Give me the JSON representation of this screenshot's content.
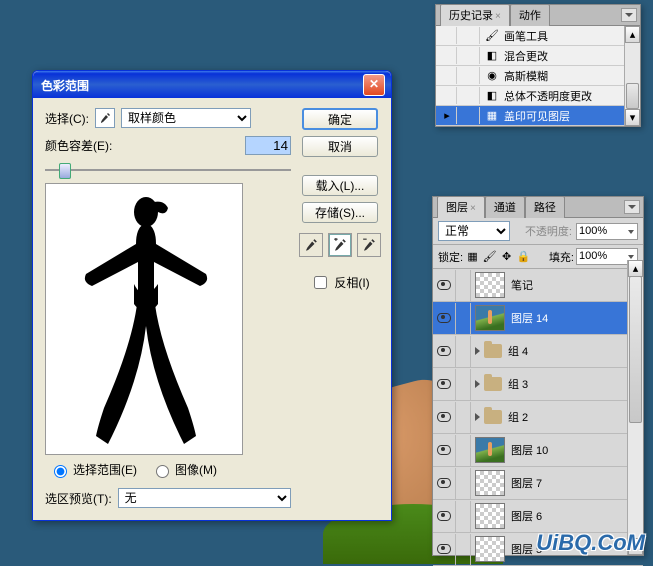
{
  "dialog": {
    "title": "色彩范围",
    "select_label": "选择(C):",
    "select_value": "取样颜色",
    "fuzziness_label": "颜色容差(E):",
    "fuzziness_value": "14",
    "radio_selection": "选择范围(E)",
    "radio_image": "图像(M)",
    "preview_label": "选区预览(T):",
    "preview_value": "无",
    "ok": "确定",
    "cancel": "取消",
    "load": "载入(L)...",
    "save": "存储(S)...",
    "invert": "反相(I)"
  },
  "history": {
    "tab_history": "历史记录",
    "tab_actions": "动作",
    "items": [
      "画笔工具",
      "混合更改",
      "高斯模糊",
      "总体不透明度更改",
      "盖印可见图层"
    ]
  },
  "layers": {
    "tab_layers": "图层",
    "tab_channels": "通道",
    "tab_paths": "路径",
    "blend_mode": "正常",
    "opacity_label": "不透明度:",
    "opacity_value": "100%",
    "lock_label": "锁定:",
    "fill_label": "填充:",
    "fill_value": "100%",
    "items": [
      {
        "name": "笔记",
        "type": "checker"
      },
      {
        "name": "图层 14",
        "type": "photo",
        "active": true
      },
      {
        "name": "组 4",
        "type": "group"
      },
      {
        "name": "组 3",
        "type": "group"
      },
      {
        "name": "组 2",
        "type": "group"
      },
      {
        "name": "图层 10",
        "type": "photo"
      },
      {
        "name": "图层 7",
        "type": "checker"
      },
      {
        "name": "图层 6",
        "type": "checker"
      },
      {
        "name": "图层 5",
        "type": "checker"
      }
    ]
  },
  "watermark": "UiBQ.CoM"
}
